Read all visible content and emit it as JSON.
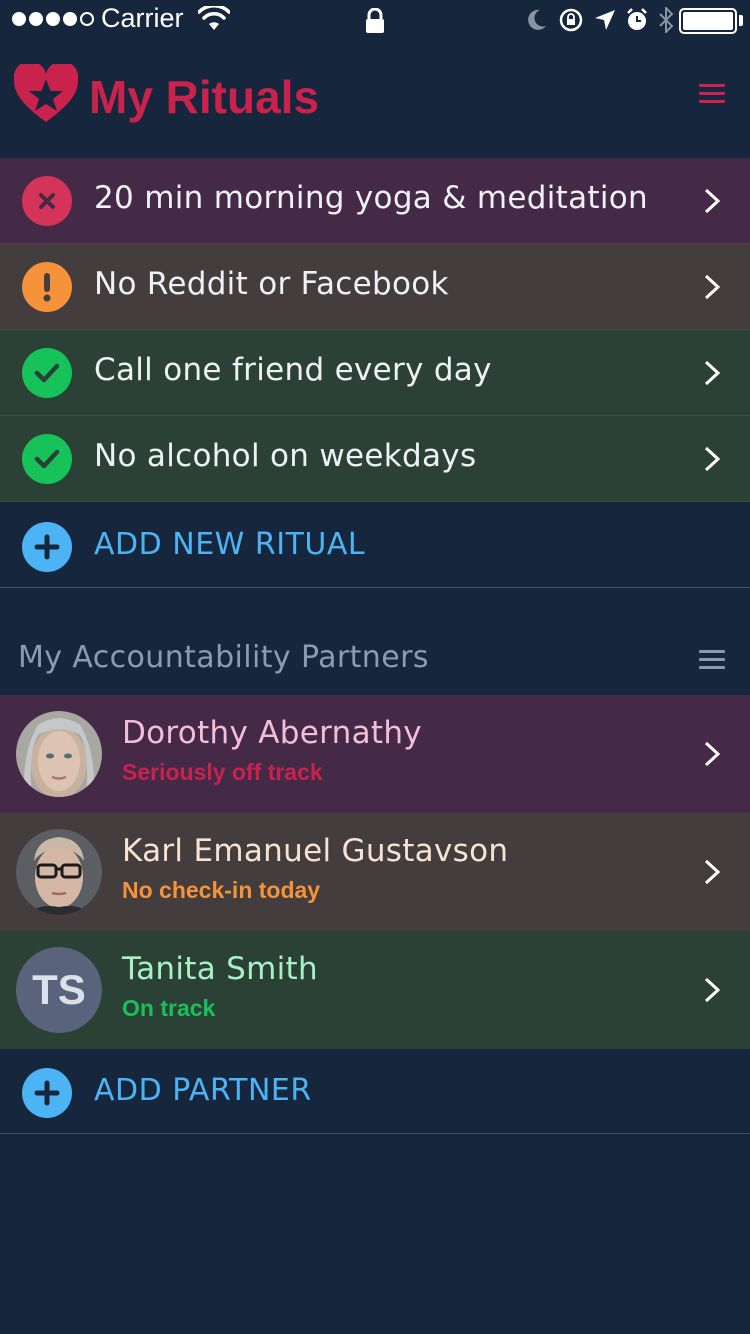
{
  "status_bar": {
    "carrier": "Carrier",
    "signal_dots_filled": 4,
    "signal_dots_total": 5,
    "battery_level": 1.0
  },
  "header": {
    "title": "My Rituals",
    "logo_icon": "heart-star-icon",
    "menu_icon": "hamburger-menu-icon"
  },
  "rituals": {
    "items": [
      {
        "label": "20 min morning yoga & meditation",
        "status": "failed",
        "icon": "x-circle-icon"
      },
      {
        "label": "No Reddit or Facebook",
        "status": "warning",
        "icon": "exclamation-circle-icon"
      },
      {
        "label": "Call one friend every day",
        "status": "done",
        "icon": "check-circle-icon"
      },
      {
        "label": "No alcohol on weekdays",
        "status": "done",
        "icon": "check-circle-icon"
      }
    ],
    "add_label": "ADD NEW RITUAL"
  },
  "partners": {
    "title": "My Accountability Partners",
    "items": [
      {
        "name": "Dorothy Abernathy",
        "status": "Seriously off track",
        "avatar": "photo"
      },
      {
        "name": "Karl Emanuel Gustavson",
        "status": "No check-in today",
        "avatar": "photo"
      },
      {
        "name": "Tanita Smith",
        "status": "On track",
        "avatar_initials": "TS"
      }
    ],
    "add_label": "ADD PARTNER"
  },
  "colors": {
    "background": "#16263d",
    "accent": "#c8224d",
    "link": "#4cb3f4",
    "red_row": "#452a47",
    "orange_row": "#433d3e",
    "green_row": "#2b4135",
    "warning": "#f6923a",
    "success": "#17c25b"
  }
}
